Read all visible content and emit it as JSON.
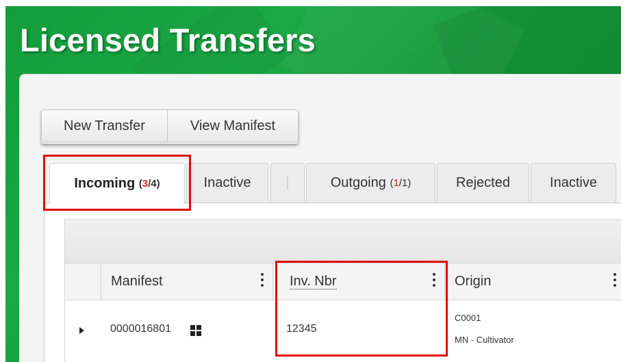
{
  "page": {
    "title": "Licensed Transfers"
  },
  "toolbar": {
    "new_transfer_label": "New Transfer",
    "view_manifest_label": "View Manifest"
  },
  "tabs": {
    "incoming": {
      "label": "Incoming",
      "count_open": "(",
      "count_red": "3",
      "count_rest": "/4)"
    },
    "incoming_inactive": {
      "label": "Inactive"
    },
    "separator": "|",
    "outgoing": {
      "label": "Outgoing",
      "count_open": "(",
      "count_red": "1",
      "count_rest": "/1)"
    },
    "rejected": {
      "label": "Rejected"
    },
    "outgoing_inactive": {
      "label": "Inactive"
    }
  },
  "grid": {
    "columns": [
      {
        "key": "manifest",
        "label": "Manifest"
      },
      {
        "key": "inv_nbr",
        "label": "Inv. Nbr"
      },
      {
        "key": "origin",
        "label": "Origin"
      }
    ],
    "rows": [
      {
        "manifest": "0000016801",
        "inv_nbr": "12345",
        "origin_code": "C0001",
        "origin_name": "MN - Cultivator"
      }
    ]
  },
  "icons": {
    "expander": "caret-right-icon",
    "manifest_view": "grid-view-icon",
    "column_menu": "kebab-menu-icon"
  },
  "colors": {
    "header_green": "#1aa844",
    "count_red": "#e0262b",
    "annotation_red": "#e0070b"
  }
}
